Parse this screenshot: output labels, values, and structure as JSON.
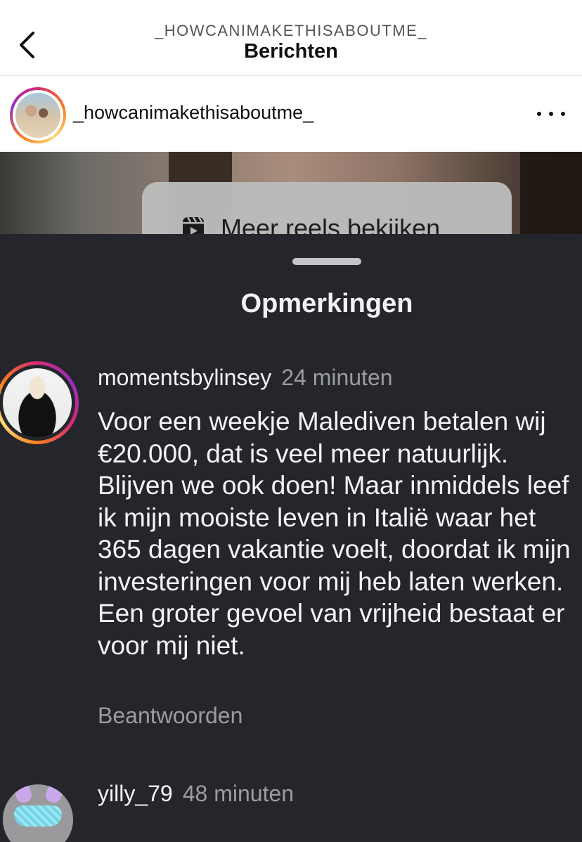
{
  "topbar": {
    "subtitle": "_HOWCANIMAKETHISABOUTME_",
    "title": "Berichten",
    "back_icon": "chevron-left-icon"
  },
  "post": {
    "username": "_howcanimakethisaboutme_",
    "more_icon": "more-horizontal-icon"
  },
  "video": {
    "reels_button_label": "Meer reels bekijken",
    "reels_icon": "reels-icon"
  },
  "comments_sheet": {
    "title": "Opmerkingen",
    "comments": [
      {
        "username": "momentsbylinsey",
        "time": "24 minuten",
        "text": "Voor een weekje Malediven betalen wij €20.000, dat is veel meer natuurlijk. Blijven we ook doen! Maar inmiddels leef ik mijn mooiste leven in Italië waar het 365 dagen vakantie voelt, doordat ik mijn investeringen voor mij heb laten werken. Een groter gevoel van vrijheid bestaat er voor mij niet.",
        "reply_label": "Beantwoorden"
      },
      {
        "username": "yilly_79",
        "time": "48 minuten",
        "text": ""
      }
    ]
  },
  "colors": {
    "sheet_background": "#24262c",
    "muted_text": "#9a9ca2",
    "story_ring_gradient": [
      "#d62976",
      "#fa7e1e",
      "#feda75",
      "#962fbf"
    ]
  }
}
